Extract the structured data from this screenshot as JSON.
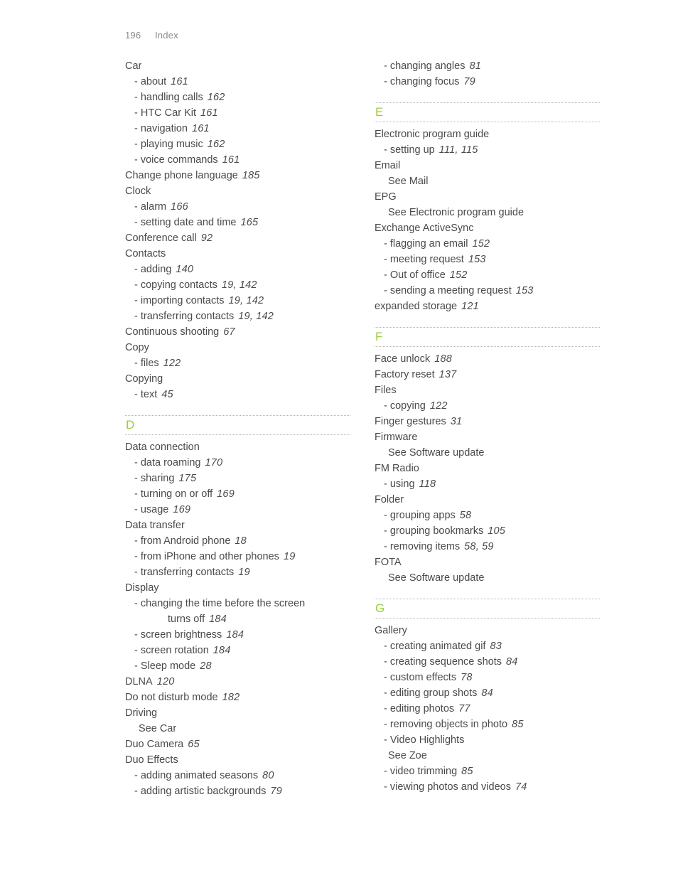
{
  "header": {
    "page_number": "196",
    "label": "Index"
  },
  "accent_color": "#9acd3c",
  "text_color": "#4a4a4a",
  "rule_color": "#b4b4b4",
  "columns": [
    {
      "name": "left-column",
      "blocks": [
        {
          "type": "entries",
          "entries": [
            {
              "kind": "head",
              "text": "Car",
              "pages": ""
            },
            {
              "kind": "sub",
              "text": "- about",
              "pages": "161"
            },
            {
              "kind": "sub",
              "text": "- handling calls",
              "pages": "162"
            },
            {
              "kind": "sub",
              "text": "- HTC Car Kit",
              "pages": "161"
            },
            {
              "kind": "sub",
              "text": "- navigation",
              "pages": "161"
            },
            {
              "kind": "sub",
              "text": "- playing music",
              "pages": "162"
            },
            {
              "kind": "sub",
              "text": "- voice commands",
              "pages": "161"
            },
            {
              "kind": "head",
              "text": "Change phone language",
              "pages": "185"
            },
            {
              "kind": "head",
              "text": "Clock",
              "pages": ""
            },
            {
              "kind": "sub",
              "text": "- alarm",
              "pages": "166"
            },
            {
              "kind": "sub",
              "text": "- setting date and time",
              "pages": "165"
            },
            {
              "kind": "head",
              "text": "Conference call",
              "pages": "92"
            },
            {
              "kind": "head",
              "text": "Contacts",
              "pages": ""
            },
            {
              "kind": "sub",
              "text": "- adding",
              "pages": "140"
            },
            {
              "kind": "sub",
              "text": "- copying contacts",
              "pages": "19, 142"
            },
            {
              "kind": "sub",
              "text": "- importing contacts",
              "pages": "19, 142"
            },
            {
              "kind": "sub",
              "text": "- transferring contacts",
              "pages": "19, 142"
            },
            {
              "kind": "head",
              "text": "Continuous shooting",
              "pages": "67"
            },
            {
              "kind": "head",
              "text": "Copy",
              "pages": ""
            },
            {
              "kind": "sub",
              "text": "- files",
              "pages": "122"
            },
            {
              "kind": "head",
              "text": "Copying",
              "pages": ""
            },
            {
              "kind": "sub",
              "text": "- text",
              "pages": "45"
            }
          ]
        },
        {
          "type": "alpha",
          "letter": "D"
        },
        {
          "type": "entries",
          "entries": [
            {
              "kind": "head",
              "text": "Data connection",
              "pages": ""
            },
            {
              "kind": "sub",
              "text": "- data roaming",
              "pages": "170"
            },
            {
              "kind": "sub",
              "text": "- sharing",
              "pages": "175"
            },
            {
              "kind": "sub",
              "text": "- turning on or off",
              "pages": "169"
            },
            {
              "kind": "sub",
              "text": "- usage",
              "pages": "169"
            },
            {
              "kind": "head",
              "text": "Data transfer",
              "pages": ""
            },
            {
              "kind": "sub",
              "text": "- from Android phone",
              "pages": "18"
            },
            {
              "kind": "sub",
              "text": "- from iPhone and other phones",
              "pages": "19"
            },
            {
              "kind": "sub",
              "text": "- transferring contacts",
              "pages": "19"
            },
            {
              "kind": "head",
              "text": "Display",
              "pages": ""
            },
            {
              "kind": "wrap",
              "text": "- changing the time before the screen",
              "cont": "turns off",
              "pages": "184"
            },
            {
              "kind": "sub",
              "text": "- screen brightness",
              "pages": "184"
            },
            {
              "kind": "sub",
              "text": "- screen rotation",
              "pages": "184"
            },
            {
              "kind": "sub",
              "text": "- Sleep mode",
              "pages": "28"
            },
            {
              "kind": "head",
              "text": "DLNA",
              "pages": "120"
            },
            {
              "kind": "head",
              "text": "Do not disturb mode",
              "pages": "182"
            },
            {
              "kind": "head",
              "text": "Driving",
              "pages": ""
            },
            {
              "kind": "see",
              "text": "See Car",
              "pages": ""
            },
            {
              "kind": "head",
              "text": "Duo Camera",
              "pages": "65"
            },
            {
              "kind": "head",
              "text": "Duo Effects",
              "pages": ""
            },
            {
              "kind": "sub",
              "text": "- adding animated seasons",
              "pages": "80"
            },
            {
              "kind": "sub",
              "text": "- adding artistic backgrounds",
              "pages": "79"
            }
          ]
        }
      ]
    },
    {
      "name": "right-column",
      "blocks": [
        {
          "type": "entries",
          "entries": [
            {
              "kind": "sub",
              "text": "- changing angles",
              "pages": "81"
            },
            {
              "kind": "sub",
              "text": "- changing focus",
              "pages": "79"
            }
          ]
        },
        {
          "type": "alpha",
          "letter": "E"
        },
        {
          "type": "entries",
          "entries": [
            {
              "kind": "head",
              "text": "Electronic program guide",
              "pages": ""
            },
            {
              "kind": "sub",
              "text": "- setting up",
              "pages": "111, 115"
            },
            {
              "kind": "head",
              "text": "Email",
              "pages": ""
            },
            {
              "kind": "see",
              "text": "See Mail",
              "pages": ""
            },
            {
              "kind": "head",
              "text": "EPG",
              "pages": ""
            },
            {
              "kind": "see",
              "text": "See Electronic program guide",
              "pages": ""
            },
            {
              "kind": "head",
              "text": "Exchange ActiveSync",
              "pages": ""
            },
            {
              "kind": "sub",
              "text": "- flagging an email",
              "pages": "152"
            },
            {
              "kind": "sub",
              "text": "- meeting request",
              "pages": "153"
            },
            {
              "kind": "sub",
              "text": "- Out of office",
              "pages": "152"
            },
            {
              "kind": "sub",
              "text": "- sending a meeting request",
              "pages": "153"
            },
            {
              "kind": "head",
              "text": "expanded storage",
              "pages": "121"
            }
          ]
        },
        {
          "type": "alpha",
          "letter": "F"
        },
        {
          "type": "entries",
          "entries": [
            {
              "kind": "head",
              "text": "Face unlock",
              "pages": "188"
            },
            {
              "kind": "head",
              "text": "Factory reset",
              "pages": "137"
            },
            {
              "kind": "head",
              "text": "Files",
              "pages": ""
            },
            {
              "kind": "sub",
              "text": "- copying",
              "pages": "122"
            },
            {
              "kind": "head",
              "text": "Finger gestures",
              "pages": "31"
            },
            {
              "kind": "head",
              "text": "Firmware",
              "pages": ""
            },
            {
              "kind": "see",
              "text": "See Software update",
              "pages": ""
            },
            {
              "kind": "head",
              "text": "FM Radio",
              "pages": ""
            },
            {
              "kind": "sub",
              "text": "- using",
              "pages": "118"
            },
            {
              "kind": "head",
              "text": "Folder",
              "pages": ""
            },
            {
              "kind": "sub",
              "text": "- grouping apps",
              "pages": "58"
            },
            {
              "kind": "sub",
              "text": "- grouping bookmarks",
              "pages": "105"
            },
            {
              "kind": "sub",
              "text": "- removing items",
              "pages": "58, 59"
            },
            {
              "kind": "head",
              "text": "FOTA",
              "pages": ""
            },
            {
              "kind": "see",
              "text": "See Software update",
              "pages": ""
            }
          ]
        },
        {
          "type": "alpha",
          "letter": "G"
        },
        {
          "type": "entries",
          "entries": [
            {
              "kind": "head",
              "text": "Gallery",
              "pages": ""
            },
            {
              "kind": "sub",
              "text": "- creating animated gif",
              "pages": "83"
            },
            {
              "kind": "sub",
              "text": "- creating sequence shots",
              "pages": "84"
            },
            {
              "kind": "sub",
              "text": "- custom effects",
              "pages": "78"
            },
            {
              "kind": "sub",
              "text": "- editing group shots",
              "pages": "84"
            },
            {
              "kind": "sub",
              "text": "- editing photos",
              "pages": "77"
            },
            {
              "kind": "sub",
              "text": "- removing objects in photo",
              "pages": "85"
            },
            {
              "kind": "sub",
              "text": "- Video Highlights",
              "pages": ""
            },
            {
              "kind": "see",
              "text": "See Zoe",
              "pages": ""
            },
            {
              "kind": "sub",
              "text": "- video trimming",
              "pages": "85"
            },
            {
              "kind": "sub",
              "text": "- viewing photos and videos",
              "pages": "74"
            }
          ]
        }
      ]
    }
  ]
}
